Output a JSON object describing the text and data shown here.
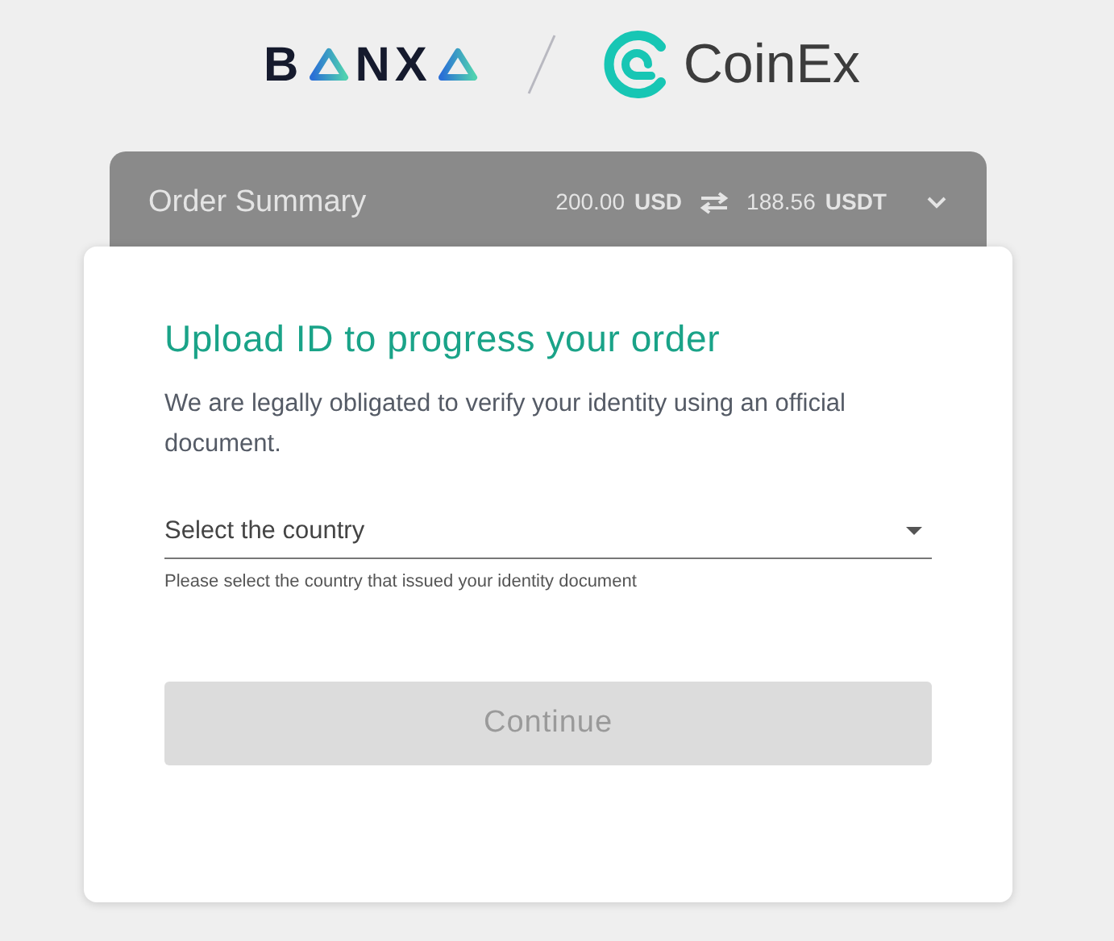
{
  "header": {
    "banxa_logo_parts": [
      "B",
      "NX"
    ],
    "coinex_logo_text": "CoinEx"
  },
  "order_summary": {
    "title": "Order Summary",
    "from_amount": "200.00",
    "from_currency": "USD",
    "to_amount": "188.56",
    "to_currency": "USDT"
  },
  "card": {
    "title": "Upload ID to progress your order",
    "description": "We are legally obligated to verify your identity using an official document.",
    "country_select": {
      "placeholder": "Select the country",
      "helper": "Please select the country that issued your identity document"
    },
    "continue_button": {
      "label": "Continue",
      "disabled": true
    }
  }
}
